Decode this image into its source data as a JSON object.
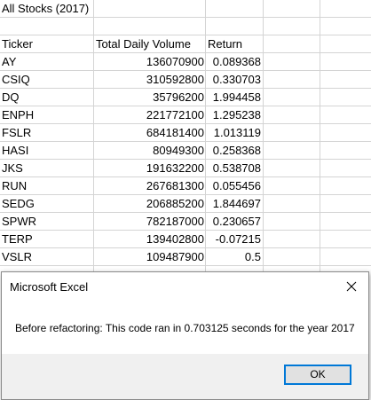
{
  "sheet": {
    "title": "All Stocks (2017)",
    "headers": [
      "Ticker",
      "Total Daily Volume",
      "Return"
    ],
    "rows": [
      {
        "ticker": "AY",
        "volume": "136070900",
        "ret": "0.089368"
      },
      {
        "ticker": "CSIQ",
        "volume": "310592800",
        "ret": "0.330703"
      },
      {
        "ticker": "DQ",
        "volume": "35796200",
        "ret": "1.994458"
      },
      {
        "ticker": "ENPH",
        "volume": "221772100",
        "ret": "1.295238"
      },
      {
        "ticker": "FSLR",
        "volume": "684181400",
        "ret": "1.013119"
      },
      {
        "ticker": "HASI",
        "volume": "80949300",
        "ret": "0.258368"
      },
      {
        "ticker": "JKS",
        "volume": "191632200",
        "ret": "0.538708"
      },
      {
        "ticker": "RUN",
        "volume": "267681300",
        "ret": "0.055456"
      },
      {
        "ticker": "SEDG",
        "volume": "206885200",
        "ret": "1.844697"
      },
      {
        "ticker": "SPWR",
        "volume": "782187000",
        "ret": "0.230657"
      },
      {
        "ticker": "TERP",
        "volume": "139402800",
        "ret": "-0.07215"
      },
      {
        "ticker": "VSLR",
        "volume": "109487900",
        "ret": "0.5"
      }
    ],
    "gridline_color": "#d4d4d4"
  },
  "dialog": {
    "title": "Microsoft Excel",
    "message": "Before refactoring: This code ran in 0.703125 seconds for the year 2017",
    "ok_label": "OK",
    "close_icon": "close-icon",
    "accent_color": "#0078d7"
  }
}
